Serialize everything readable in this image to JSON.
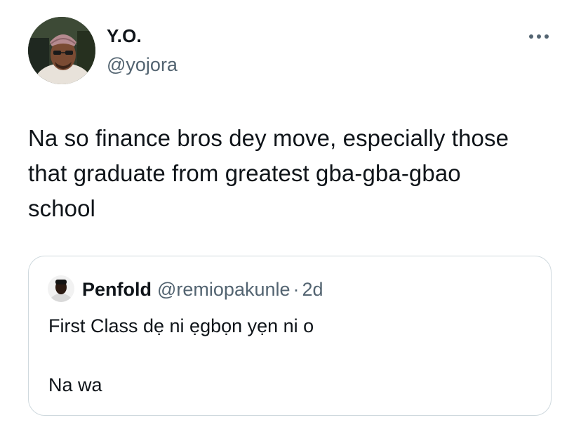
{
  "author": {
    "display_name": "Y.O.",
    "handle": "@yojora"
  },
  "tweet": {
    "text_lines": [
      "Na so finance bros dey move, especially those",
      "that graduate from greatest gba-gba-gbao",
      "school"
    ]
  },
  "quoted_tweet": {
    "display_name": "Penfold",
    "handle": "@remiopakunle",
    "separator": "·",
    "time": "2d",
    "lines": [
      "First Class dẹ ni ẹgbọn yẹn ni o",
      "Na wa"
    ]
  },
  "icons": {
    "more": "more-horizontal-icon"
  },
  "colors": {
    "text": "#0f1419",
    "secondary": "#536471",
    "border": "#cfd9de"
  }
}
